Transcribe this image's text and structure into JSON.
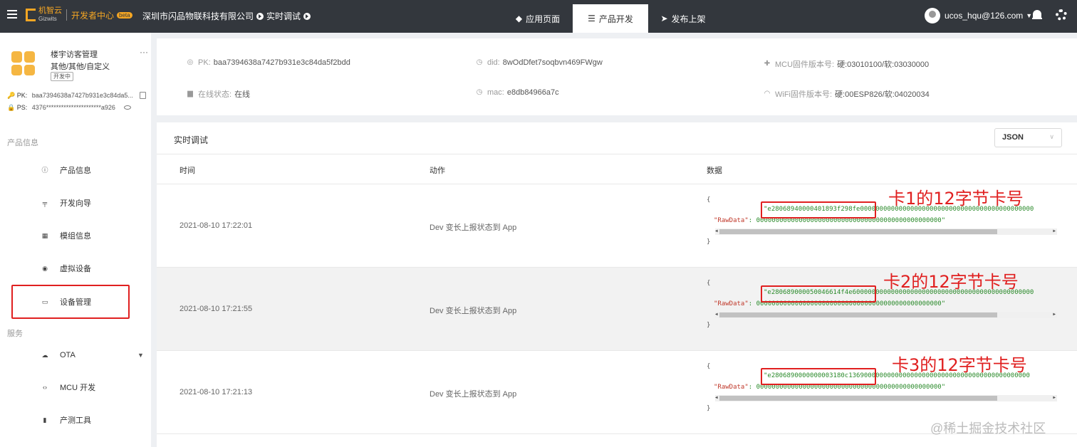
{
  "header": {
    "logo_text": "机智云",
    "logo_sub": "Gizwits",
    "dev_center": "开发者中心",
    "beta": "beta",
    "company": "深圳市闪品物联科技有限公司",
    "mode": "实时调试",
    "tabs": [
      {
        "label": "应用页面",
        "icon": "diamond-icon"
      },
      {
        "label": "产品开发",
        "icon": "sliders-icon"
      },
      {
        "label": "发布上架",
        "icon": "send-icon"
      }
    ],
    "user": "ucos_hqu@126.com"
  },
  "sidebar": {
    "product_name": "楼宇访客管理",
    "category": "其他/其他/自定义",
    "status": "开发中",
    "pk_label": "PK:",
    "pk_value": "baa7394638a7427b931e3c84da5...",
    "ps_label": "PS:",
    "ps_value": "4376**********************a926",
    "section_product": "产品信息",
    "section_service": "服务",
    "items": [
      {
        "label": "产品信息",
        "icon": "info-icon"
      },
      {
        "label": "开发向导",
        "icon": "signpost-icon"
      },
      {
        "label": "模组信息",
        "icon": "module-icon"
      },
      {
        "label": "虚拟设备",
        "icon": "virtual-device-icon"
      },
      {
        "label": "设备管理",
        "icon": "device-icon"
      },
      {
        "label": "OTA",
        "icon": "cloud-icon"
      },
      {
        "label": "MCU 开发",
        "icon": "code-icon"
      },
      {
        "label": "产测工具",
        "icon": "tool-icon"
      }
    ]
  },
  "device_info": {
    "pk_label": "PK:",
    "pk": "baa7394638a7427b931e3c84da5f2bdd",
    "did_label": "did:",
    "did": "8wOdDfet7soqbvn469FWgw",
    "mcu_label": "MCU固件版本号:",
    "mcu": "硬:03010100/软:03030000",
    "online_label": "在线状态:",
    "online": "在线",
    "mac_label": "mac:",
    "mac": "e8db84966a7c",
    "wifi_label": "WiFi固件版本号:",
    "wifi": "硬:00ESP826/软:04020034"
  },
  "debug": {
    "title": "实时调试",
    "format": "JSON",
    "columns": [
      "时间",
      "动作",
      "数据"
    ],
    "rows": [
      {
        "time": "2021-08-10 17:22:01",
        "action": "Dev 变长上报状态到 App",
        "line1": "\"e28068940000401893f298fe000000000000000000000000000000000000000000000",
        "raw_key": "\"RawData\"",
        "raw_val": ": 000000000000000000000000000000000000000000000000\"",
        "annotation": "卡1的12字节卡号"
      },
      {
        "time": "2021-08-10 17:21:55",
        "action": "Dev 变长上报状态到 App",
        "line1": "\"e280689000050046614f4e60000000000000000000000000000000000000000000000",
        "raw_key": "\"RawData\"",
        "raw_val": ": 000000000000000000000000000000000000000000000000\"",
        "annotation": "卡2的12字节卡号"
      },
      {
        "time": "2021-08-10 17:21:13",
        "action": "Dev 变长上报状态到 App",
        "line1": "\"e2806890000000003180c13690000000000000000000000000000000000000000000",
        "raw_key": "\"RawData\"",
        "raw_val": ": 000000000000000000000000000000000000000000000000\"",
        "annotation": "卡3的12字节卡号"
      }
    ],
    "open_brace": "{",
    "close_brace": "}"
  },
  "watermark": "@稀土掘金技术社区",
  "colors": {
    "topbar": "#33373d",
    "accent": "#f5a623",
    "annotation": "#e02020",
    "json_value": "#2a8a2a",
    "json_key": "#c0392b"
  }
}
